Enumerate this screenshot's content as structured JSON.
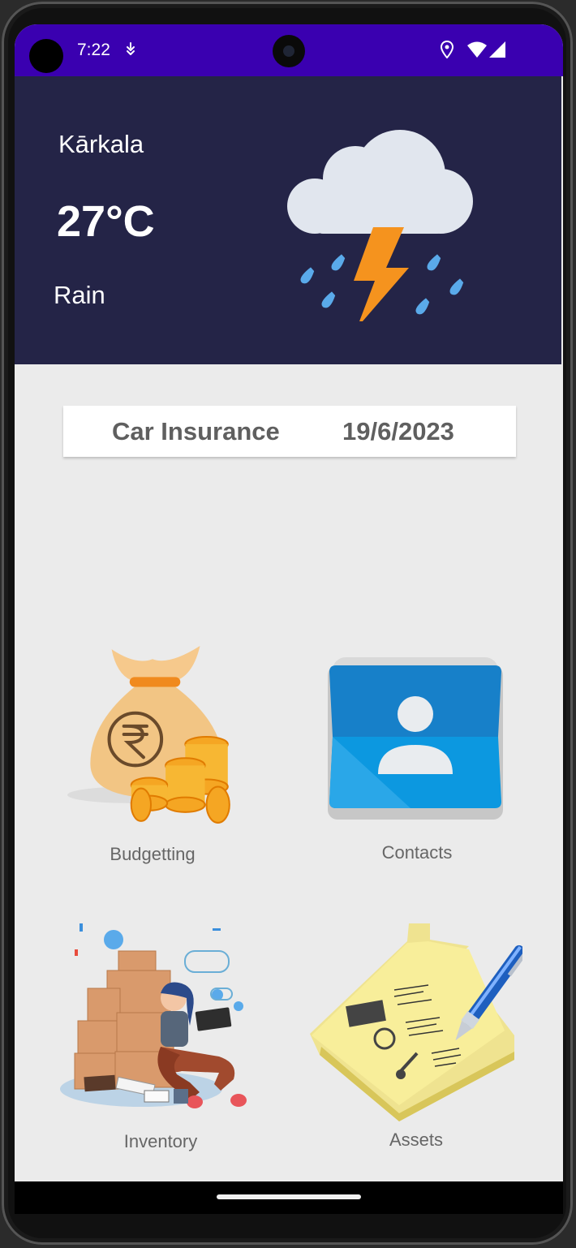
{
  "status_bar": {
    "time": "7:22",
    "icons": [
      "notification-icon",
      "location-icon",
      "wifi-icon",
      "signal-icon"
    ]
  },
  "weather": {
    "city": "Kārkala",
    "temperature": "27°C",
    "condition": "Rain",
    "icon": "thunderstorm-rain-icon"
  },
  "reminder": {
    "title": "Car Insurance",
    "date": "19/6/2023"
  },
  "tiles": [
    {
      "label": "Budgetting",
      "icon": "money-bag-rupee-icon"
    },
    {
      "label": "Contacts",
      "icon": "contacts-book-icon"
    },
    {
      "label": "Inventory",
      "icon": "inventory-boxes-icon"
    },
    {
      "label": "Assets",
      "icon": "assets-house-note-icon"
    }
  ],
  "colors": {
    "status_bar": "#3a00b0",
    "weather_bg": "#242447",
    "screen_bg": "#ebebeb"
  }
}
